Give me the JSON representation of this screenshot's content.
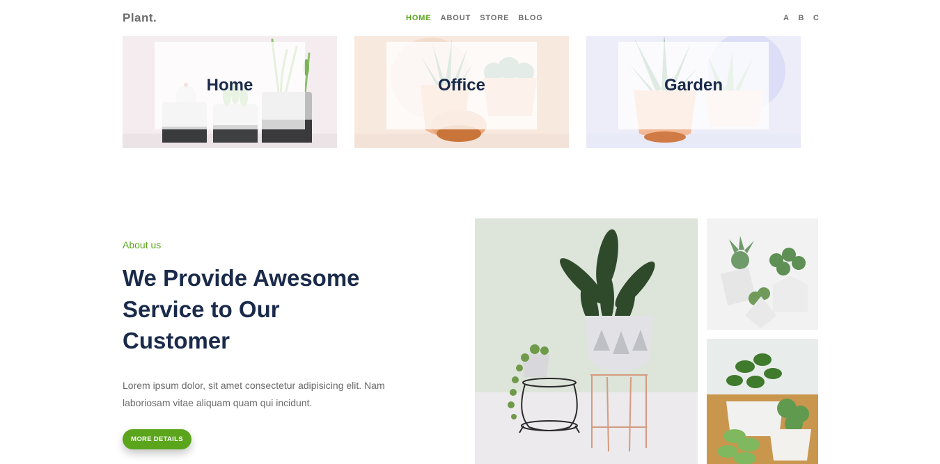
{
  "header": {
    "logo": "Plant.",
    "nav": [
      {
        "label": "HOME",
        "active": true
      },
      {
        "label": "ABOUT",
        "active": false
      },
      {
        "label": "STORE",
        "active": false
      },
      {
        "label": "BLOG",
        "active": false
      }
    ],
    "letters": [
      "A",
      "B",
      "C"
    ]
  },
  "categories": [
    {
      "label": "Home"
    },
    {
      "label": "Office"
    },
    {
      "label": "Garden"
    }
  ],
  "about": {
    "eyebrow": "About us",
    "title": "We Provide Awesome Service to Our Customer",
    "text": "Lorem ipsum dolor, sit amet consectetur adipisicing elit. Nam laboriosam vitae aliquam quam qui incidunt.",
    "button_label": "MORE DETAILS"
  },
  "colors": {
    "accent": "#5aa51c",
    "heading": "#1a2a4a",
    "muted": "#6f6f6f"
  }
}
